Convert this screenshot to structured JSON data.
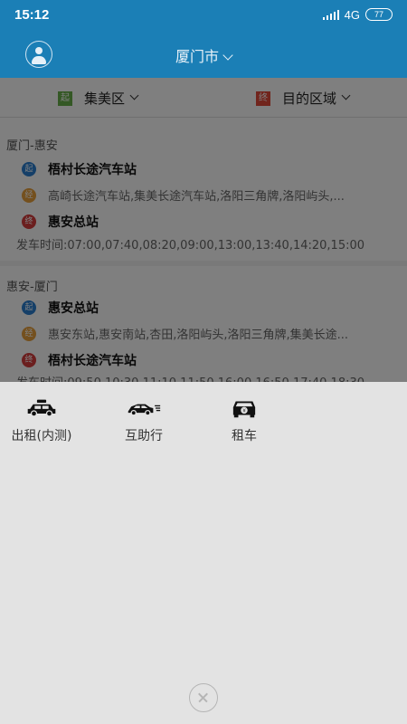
{
  "status_bar": {
    "time": "15:12",
    "network": "4G",
    "battery": "77"
  },
  "header": {
    "city": "厦门市"
  },
  "filters": {
    "origin_tag": "起",
    "origin": "集美区",
    "destination_tag": "终",
    "destination": "目的区域"
  },
  "routes": [
    {
      "title": "厦门-惠安",
      "start_tag": "起",
      "start": "梧村长途汽车站",
      "via_tag": "经",
      "via": "高崎长途汽车站,集美长途汽车站,洛阳三角牌,洛阳屿头,...",
      "end_tag": "终",
      "end": "惠安总站",
      "departures": "发车时间:07:00,07:40,08:20,09:00,13:00,13:40,14:20,15:00"
    },
    {
      "title": "惠安-厦门",
      "start_tag": "起",
      "start": "惠安总站",
      "via_tag": "经",
      "via": "惠安东站,惠安南站,杏田,洛阳屿头,洛阳三角牌,集美长途...",
      "end_tag": "终",
      "end": "梧村长途汽车站",
      "departures": "发车时间:09:50,10:30,11:10,11:50,16:00,16:50,17:40,18:30"
    }
  ],
  "services": [
    {
      "label": "出租(内测)",
      "icon": "taxi-icon"
    },
    {
      "label": "互助行",
      "icon": "fast-car-icon"
    },
    {
      "label": "租车",
      "icon": "rental-car-icon"
    }
  ],
  "colors": {
    "primary": "#1b7fb6",
    "sheet": "#e3e3e3"
  }
}
